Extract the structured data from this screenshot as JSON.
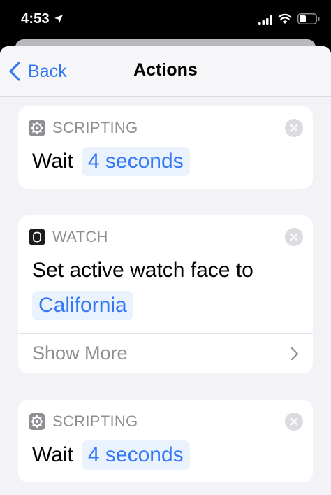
{
  "status_bar": {
    "time": "4:53"
  },
  "nav": {
    "back_label": "Back",
    "title": "Actions"
  },
  "actions": [
    {
      "category": "SCRIPTING",
      "icon": "gear-icon",
      "text": "Wait",
      "parameter": "4 seconds"
    },
    {
      "category": "WATCH",
      "icon": "watch-icon",
      "text": "Set active watch face to",
      "parameter": "California",
      "show_more": "Show More"
    },
    {
      "category": "SCRIPTING",
      "icon": "gear-icon",
      "text": "Wait",
      "parameter": "4 seconds"
    }
  ],
  "colors": {
    "accent": "#3478f6",
    "token_bg": "#eaf2fd",
    "secondary_text": "#8e8e93",
    "background": "#f2f2f7"
  }
}
